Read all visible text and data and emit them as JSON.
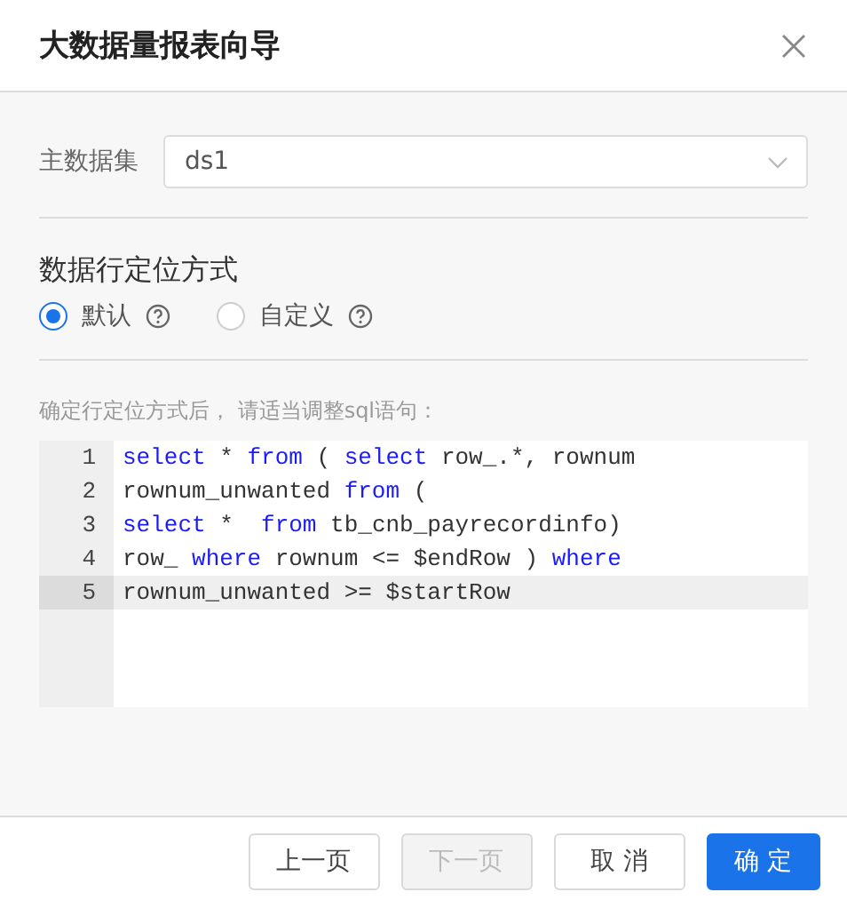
{
  "dialog": {
    "title": "大数据量报表向导"
  },
  "dataset": {
    "label": "主数据集",
    "value": "ds1"
  },
  "positioning": {
    "title": "数据行定位方式",
    "options": [
      {
        "label": "默认",
        "selected": true
      },
      {
        "label": "自定义",
        "selected": false
      }
    ]
  },
  "hint": "确定行定位方式后， 请适当调整sql语句：",
  "editor": {
    "lines": [
      {
        "number": "1",
        "selected": false,
        "tokens": [
          {
            "kind": "keyword",
            "text": "select"
          },
          {
            "kind": "plain",
            "text": " * "
          },
          {
            "kind": "keyword",
            "text": "from"
          },
          {
            "kind": "plain",
            "text": " ( "
          },
          {
            "kind": "keyword",
            "text": "select"
          },
          {
            "kind": "plain",
            "text": " row_.*, rownum"
          }
        ]
      },
      {
        "number": "2",
        "selected": false,
        "tokens": [
          {
            "kind": "plain",
            "text": "rownum_unwanted "
          },
          {
            "kind": "keyword",
            "text": "from"
          },
          {
            "kind": "plain",
            "text": " ("
          }
        ]
      },
      {
        "number": "3",
        "selected": false,
        "tokens": [
          {
            "kind": "keyword",
            "text": "select"
          },
          {
            "kind": "plain",
            "text": " *  "
          },
          {
            "kind": "keyword",
            "text": "from"
          },
          {
            "kind": "plain",
            "text": " tb_cnb_payrecordinfo)"
          }
        ]
      },
      {
        "number": "4",
        "selected": false,
        "tokens": [
          {
            "kind": "plain",
            "text": "row_ "
          },
          {
            "kind": "keyword",
            "text": "where"
          },
          {
            "kind": "plain",
            "text": " rownum <= $endRow ) "
          },
          {
            "kind": "keyword",
            "text": "where"
          }
        ]
      },
      {
        "number": "5",
        "selected": true,
        "tokens": [
          {
            "kind": "plain",
            "text": "rownum_unwanted >= $startRow"
          }
        ]
      }
    ]
  },
  "buttons": [
    {
      "label": "上一页",
      "kind": "default",
      "disabled": false
    },
    {
      "label": "下一页",
      "kind": "default",
      "disabled": true
    },
    {
      "label": "取 消",
      "kind": "default",
      "disabled": false
    },
    {
      "label": "确 定",
      "kind": "primary",
      "disabled": false
    }
  ]
}
